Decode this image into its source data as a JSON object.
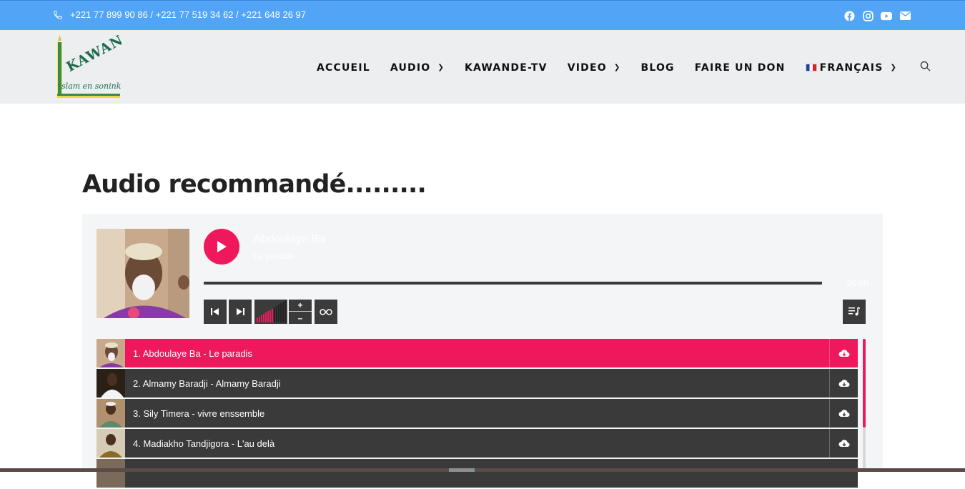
{
  "topbar": {
    "phone": "+221 77 899 90 86 / +221 77 519 34 62 / +221 648 26 97",
    "social_icons": [
      "facebook-icon",
      "instagram-icon",
      "youtube-icon",
      "mail-icon"
    ]
  },
  "logo": {
    "word": "KAWANDE",
    "tagline": "Islam en soninké"
  },
  "nav": {
    "items": [
      {
        "label": "ACCUEIL",
        "dropdown": false
      },
      {
        "label": "AUDIO",
        "dropdown": true
      },
      {
        "label": "KAWANDE-TV",
        "dropdown": false
      },
      {
        "label": "VIDEO",
        "dropdown": true
      },
      {
        "label": "BLOG",
        "dropdown": false
      },
      {
        "label": "FAIRE UN DON",
        "dropdown": false
      }
    ],
    "language": "FRANÇAIS"
  },
  "page": {
    "title": "Audio recommandé........."
  },
  "player": {
    "artist": "Abdoulaye Ba",
    "title": "Le paradis",
    "time": "00:00",
    "volume": 0.6,
    "accent": "#f0185d"
  },
  "playlist": [
    {
      "label": "1. Abdoulaye Ba - Le paradis",
      "active": true
    },
    {
      "label": "2. Almamy Baradji - Almamy Baradji",
      "active": false
    },
    {
      "label": "3. Sily Timera - vivre enssemble",
      "active": false
    },
    {
      "label": "4. Madiakho Tandjigora - L'au delà",
      "active": false
    }
  ]
}
